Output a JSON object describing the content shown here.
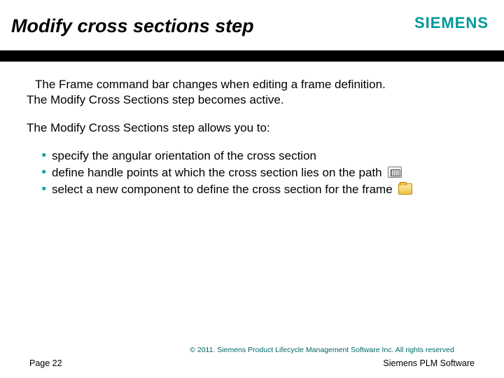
{
  "header": {
    "title": "Modify cross sections step",
    "brand": "SIEMENS"
  },
  "body": {
    "paragraph1_line1": "The Frame command bar changes when editing a frame definition.",
    "paragraph1_line2": "The Modify Cross Sections step becomes active.",
    "paragraph2": "The Modify Cross Sections step allows you to:",
    "bullets": [
      "specify the angular orientation of the cross section",
      "define handle points at which the cross section lies on the path",
      "select a new component to define the cross section for the frame"
    ]
  },
  "footer": {
    "copyright": "© 2011. Siemens Product Lifecycle Management Software Inc. All rights reserved",
    "page": "Page 22",
    "product": "Siemens PLM Software"
  }
}
